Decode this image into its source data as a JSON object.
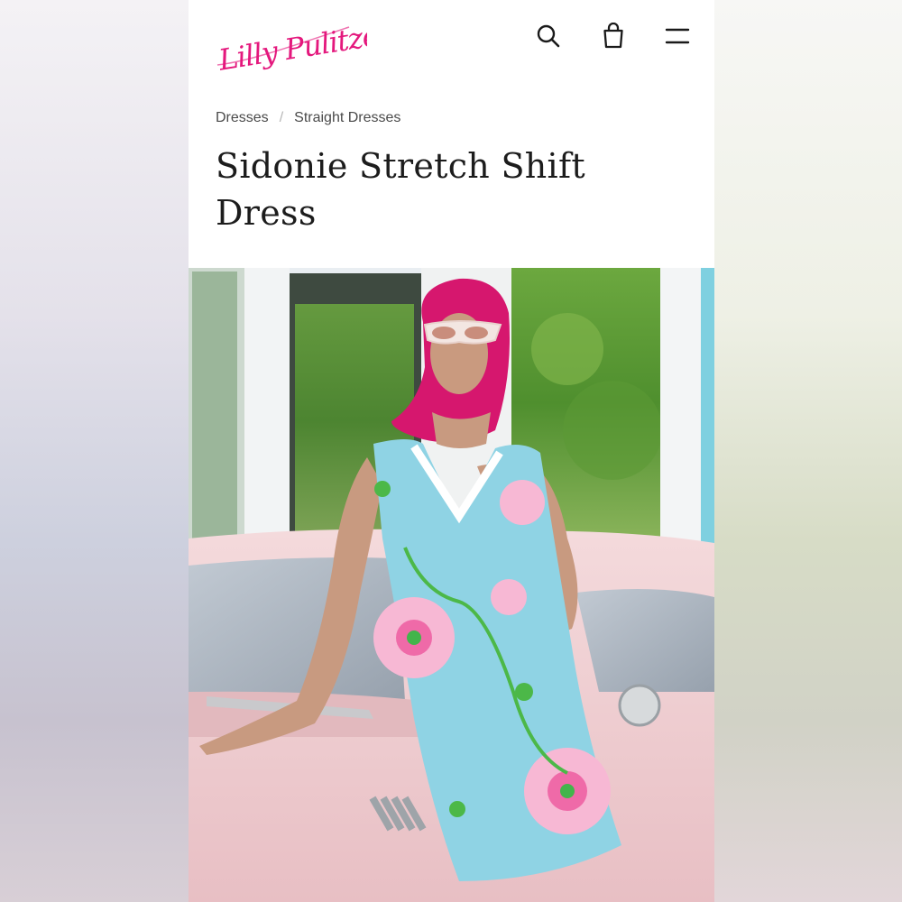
{
  "brand": {
    "logo_text": "Lilly Pulitzer",
    "brand_color": "#e4187d"
  },
  "header": {
    "icons": [
      "search-icon",
      "shopping-bag-icon",
      "hamburger-menu-icon"
    ]
  },
  "breadcrumb": {
    "items": [
      "Dresses",
      "Straight Dresses"
    ],
    "separator": "/"
  },
  "product": {
    "title": "Sidonie Stretch Shift Dress"
  },
  "hero_image": {
    "dress_color": "#8fd3e4",
    "scarf_color": "#d6176e",
    "car_color": "#f0cfd2"
  }
}
